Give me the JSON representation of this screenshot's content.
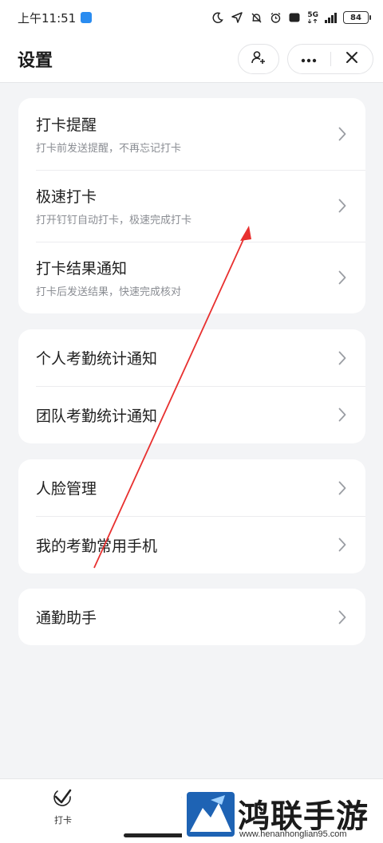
{
  "status_bar": {
    "time": "上午11:51",
    "network": "5G",
    "battery": "84"
  },
  "header": {
    "title": "设置"
  },
  "cards": [
    {
      "rows": [
        {
          "title": "打卡提醒",
          "subtitle": "打卡前发送提醒，不再忘记打卡"
        },
        {
          "title": "极速打卡",
          "subtitle": "打开钉钉自动打卡，极速完成打卡"
        },
        {
          "title": "打卡结果通知",
          "subtitle": "打卡后发送结果，快速完成核对"
        }
      ]
    },
    {
      "rows": [
        {
          "title": "个人考勤统计通知"
        },
        {
          "title": "团队考勤统计通知"
        }
      ]
    },
    {
      "rows": [
        {
          "title": "人脸管理"
        },
        {
          "title": "我的考勤常用手机"
        }
      ]
    },
    {
      "rows": [
        {
          "title": "通勤助手"
        }
      ]
    }
  ],
  "bottom_nav": {
    "items": [
      {
        "label": "打卡",
        "icon": "check-icon"
      }
    ]
  },
  "watermark": {
    "title": "鸿联手游网",
    "url": "www.henanhonglian95.com"
  },
  "colors": {
    "background": "#f3f4f6",
    "card": "#ffffff",
    "annotation_arrow": "#e8302f"
  }
}
